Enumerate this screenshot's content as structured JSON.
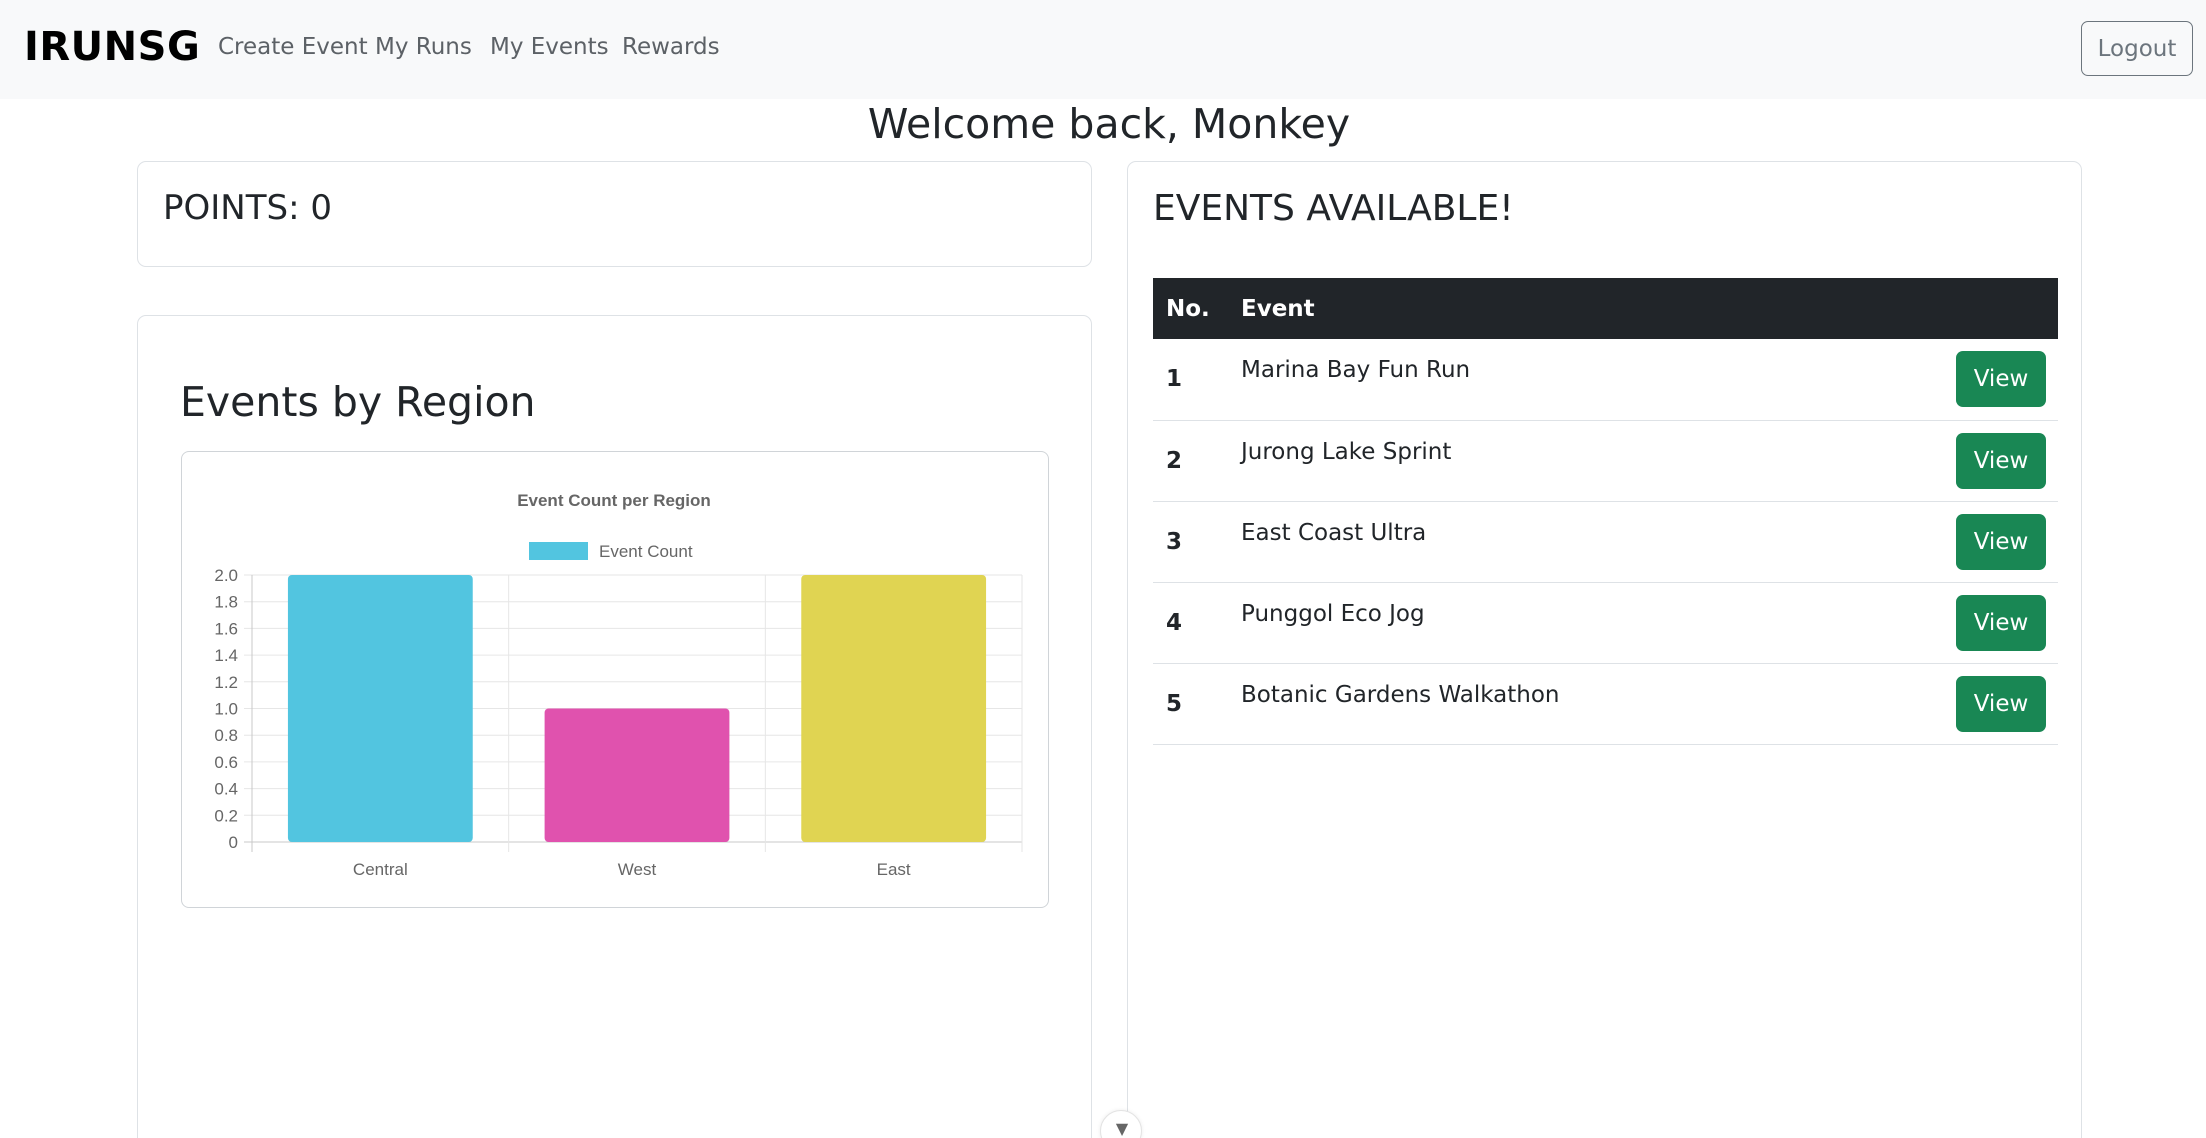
{
  "navbar": {
    "brand": "IRUNSG",
    "links": [
      "Create Event",
      "My Runs",
      "My Events",
      "Rewards"
    ],
    "logout_label": "Logout"
  },
  "welcome": "Welcome back, Monkey",
  "points_label": "POINTS: 0",
  "region_section": {
    "title": "Events by Region"
  },
  "chart_data": {
    "type": "bar",
    "title": "Event Count per Region",
    "categories": [
      "Central",
      "West",
      "East"
    ],
    "series": [
      {
        "name": "Event Count",
        "values": [
          2,
          1,
          2
        ]
      }
    ],
    "bar_colors": [
      "#52c5e0",
      "#e052ae",
      "#e0d452"
    ],
    "legend_color": "#52c5e0",
    "yticks": [
      "0",
      "0.2",
      "0.4",
      "0.6",
      "0.8",
      "1.0",
      "1.2",
      "1.4",
      "1.6",
      "1.8",
      "2.0"
    ],
    "ylim": [
      0,
      2
    ],
    "grid": true,
    "legend_position": "top",
    "xlabel": "",
    "ylabel": ""
  },
  "events_section": {
    "title": "EVENTS AVAILABLE!",
    "headers": [
      "No.",
      "Event"
    ],
    "view_label": "View",
    "rows": [
      {
        "no": "1",
        "name": "Marina Bay Fun Run"
      },
      {
        "no": "2",
        "name": "Jurong Lake Sprint"
      },
      {
        "no": "3",
        "name": "East Coast Ultra"
      },
      {
        "no": "4",
        "name": "Punggol Eco Jog"
      },
      {
        "no": "5",
        "name": "Botanic Gardens Walkathon"
      }
    ]
  },
  "scroll_icon": "chevron-down-icon"
}
